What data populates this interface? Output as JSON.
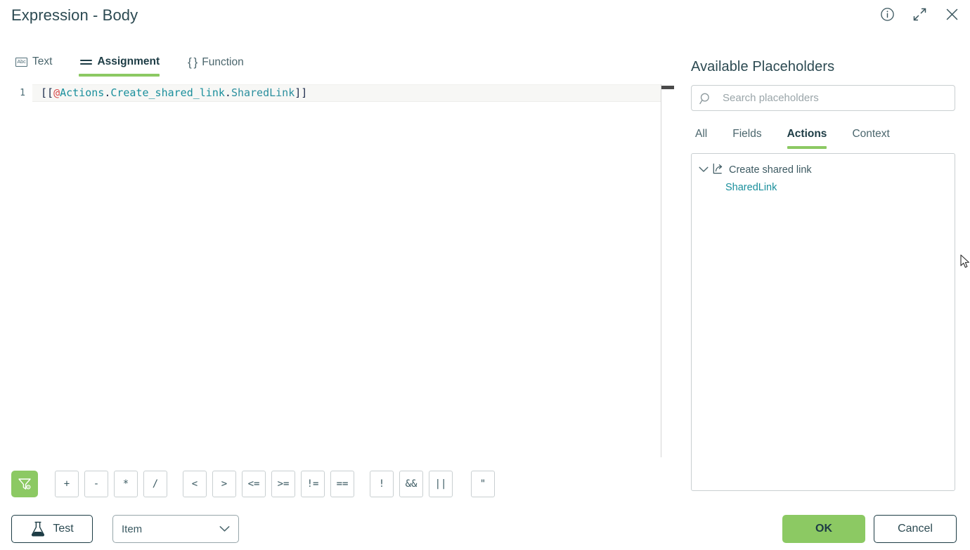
{
  "dialog": {
    "title": "Expression - Body",
    "window_icons": [
      {
        "name": "info-icon",
        "glyph": "i"
      },
      {
        "name": "expand-icon",
        "glyph": "expand"
      },
      {
        "name": "close-icon",
        "glyph": "x"
      }
    ]
  },
  "editor_tabs": [
    {
      "label": "Text",
      "icon": "abc-icon",
      "icon_text": "Abc",
      "active": false
    },
    {
      "label": "Assignment",
      "icon": "equals-icon",
      "active": true
    },
    {
      "label": "Function",
      "icon": "braces-icon",
      "icon_text": "{ }",
      "active": false
    }
  ],
  "editor": {
    "line_number": "1",
    "expression": "[[@Actions.Create_shared_link.SharedLink]]",
    "tokens": [
      {
        "text": "[[",
        "type": "bracket"
      },
      {
        "text": "@",
        "type": "at"
      },
      {
        "text": "Actions",
        "type": "identifier"
      },
      {
        "text": ".",
        "type": "dot"
      },
      {
        "text": "Create_shared_link",
        "type": "identifier"
      },
      {
        "text": ".",
        "type": "dot"
      },
      {
        "text": "SharedLink",
        "type": "leaf"
      },
      {
        "text": "]]",
        "type": "bracket"
      }
    ]
  },
  "toolbar": {
    "filter_button_label": "filter-settings",
    "operator_groups": [
      [
        "+",
        "-",
        "*",
        "/"
      ],
      [
        "<",
        ">",
        "<=",
        ">=",
        "!=",
        "=="
      ],
      [
        "!",
        "&&",
        "||"
      ],
      [
        "\""
      ]
    ]
  },
  "bottom": {
    "test_label": "Test",
    "item_select_value": "Item"
  },
  "placeholders": {
    "title": "Available Placeholders",
    "search_placeholder": "Search placeholders",
    "search_value": "",
    "tabs": [
      {
        "label": "All",
        "active": false
      },
      {
        "label": "Fields",
        "active": false
      },
      {
        "label": "Actions",
        "active": true
      },
      {
        "label": "Context",
        "active": false
      }
    ],
    "tree": [
      {
        "label": "Create shared link",
        "expanded": true,
        "children": [
          {
            "label": "SharedLink"
          }
        ]
      }
    ]
  },
  "actions": {
    "ok_label": "OK",
    "cancel_label": "Cancel"
  },
  "colors": {
    "accent_green": "#8cc963",
    "dark_navy": "#1d3c45",
    "teal_text": "#1a8f9c",
    "at_red": "#d94a4a"
  }
}
